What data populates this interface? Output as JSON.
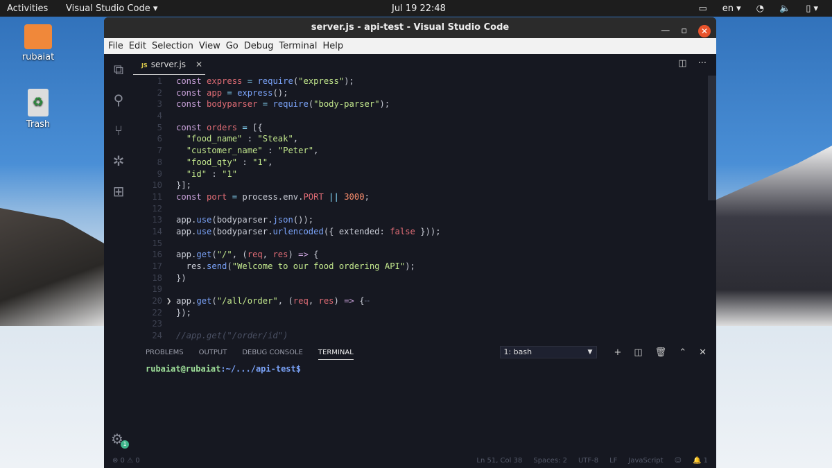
{
  "topbar": {
    "activities": "Activities",
    "app": "Visual Studio Code ▾",
    "clock": "Jul 19  22:48",
    "lang": "en ▾"
  },
  "desktop": [
    {
      "label": "rubaiat",
      "icon": "home-folder-icon"
    },
    {
      "label": "Trash",
      "icon": "trash-icon"
    }
  ],
  "window": {
    "title": "server.js - api-test - Visual Studio Code",
    "menu": [
      "File",
      "Edit",
      "Selection",
      "View",
      "Go",
      "Debug",
      "Terminal",
      "Help"
    ]
  },
  "tab": {
    "badge": "JS",
    "name": "server.js",
    "close": "✕"
  },
  "code": [
    {
      "n": "1",
      "h": "<span class=k>const</span> <span class=v>express</span> <span class=p>=</span> <span class=f>require</span>(<span class=s>\"express\"</span>);"
    },
    {
      "n": "2",
      "h": "<span class=k>const</span> <span class=v>app</span> <span class=p>=</span> <span class=f>express</span>();"
    },
    {
      "n": "3",
      "h": "<span class=k>const</span> <span class=v>bodyparser</span> <span class=p>=</span> <span class=f>require</span>(<span class=s>\"body-parser\"</span>);"
    },
    {
      "n": "4",
      "h": ""
    },
    {
      "n": "5",
      "h": "<span class=k>const</span> <span class=v>orders</span> <span class=p>=</span> [{"
    },
    {
      "n": "6",
      "h": "  <span class=s>\"food_name\"</span> : <span class=s>\"Steak\"</span>,"
    },
    {
      "n": "7",
      "h": "  <span class=s>\"customer_name\"</span> : <span class=s>\"Peter\"</span>,"
    },
    {
      "n": "8",
      "h": "  <span class=s>\"food_qty\"</span> : <span class=s>\"1\"</span>,"
    },
    {
      "n": "9",
      "h": "  <span class=s>\"id\"</span> : <span class=s>\"1\"</span>"
    },
    {
      "n": "10",
      "h": "}];"
    },
    {
      "n": "11",
      "h": "<span class=k>const</span> <span class=v>port</span> <span class=p>=</span> process.env.<span class=v>PORT</span> <span class=p>||</span> <span class=n>3000</span>;"
    },
    {
      "n": "12",
      "h": ""
    },
    {
      "n": "13",
      "h": "app.<span class=f>use</span>(bodyparser.<span class=f>json</span>());"
    },
    {
      "n": "14",
      "h": "app.<span class=f>use</span>(bodyparser.<span class=f>urlencoded</span>({ extended: <span class=v>false</span> }));"
    },
    {
      "n": "15",
      "h": ""
    },
    {
      "n": "16",
      "h": "app.<span class=f>get</span>(<span class=s>\"/\"</span>, (<span class=v>req</span>, <span class=v>res</span>) <span class=k>=&gt;</span> {"
    },
    {
      "n": "17",
      "h": "  res.<span class=f>send</span>(<span class=s>\"Welcome to our food ordering API\"</span>);"
    },
    {
      "n": "18",
      "h": "})"
    },
    {
      "n": "19",
      "h": ""
    },
    {
      "n": "20",
      "h": "app.<span class=f>get</span>(<span class=s>\"/all/order\"</span>, (<span class=v>req</span>, <span class=v>res</span>) <span class=k>=&gt;</span> {<span class=c>⋯</span>",
      "fold": true
    },
    {
      "n": "22",
      "h": "});"
    },
    {
      "n": "23",
      "h": ""
    },
    {
      "n": "24",
      "h": "<span class=c>//app.get(\"/order/id\")</span>"
    }
  ],
  "panel": {
    "tabs": [
      "PROBLEMS",
      "OUTPUT",
      "DEBUG CONSOLE",
      "TERMINAL"
    ],
    "active": 3,
    "shell": "1: bash"
  },
  "terminal": {
    "user": "rubaiat@rubaiat",
    "path": ":~/.../api-test$"
  },
  "settings_badge": "1",
  "status": {
    "left": "⊗ 0 ⚠ 0",
    "items": [
      "Ln 51, Col 38",
      "Spaces: 2",
      "UTF-8",
      "LF",
      "JavaScript",
      "☺",
      "🔔 1"
    ]
  }
}
